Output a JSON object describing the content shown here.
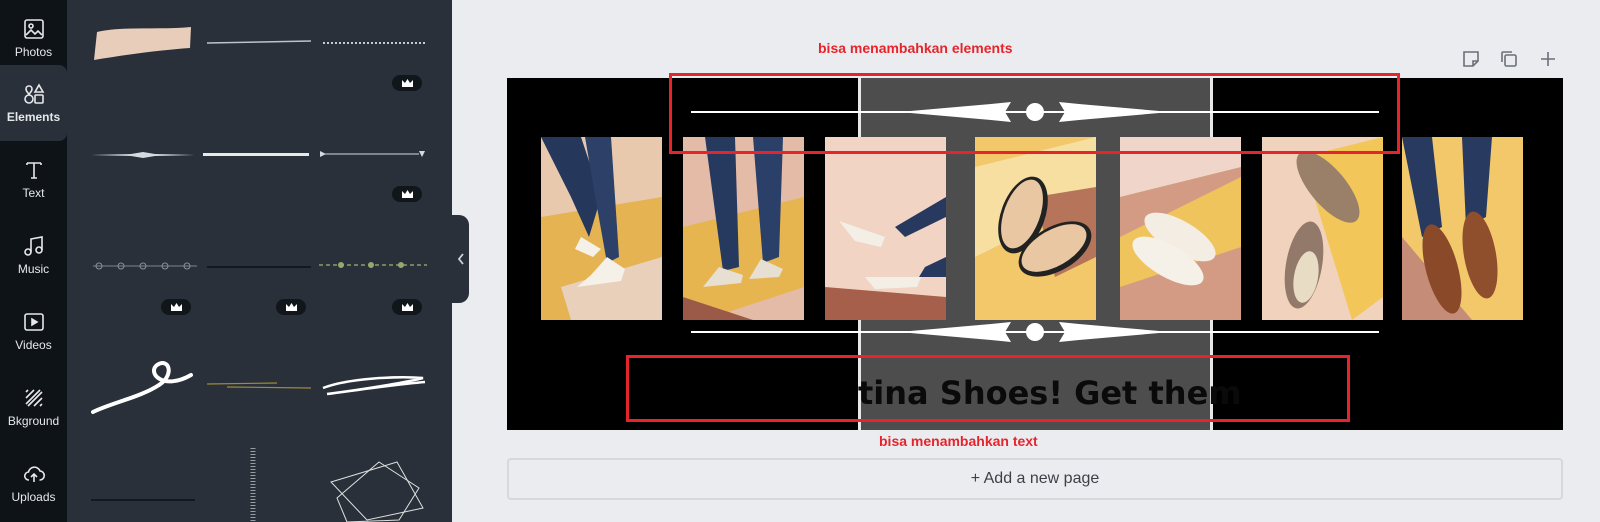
{
  "rail": {
    "items": [
      {
        "label": "Photos"
      },
      {
        "label": "Elements"
      },
      {
        "label": "Text"
      },
      {
        "label": "Music"
      },
      {
        "label": "Videos"
      },
      {
        "label": "Bkground"
      },
      {
        "label": "Uploads"
      }
    ],
    "active": "Elements"
  },
  "annotations": {
    "elements_note": "bisa menambahkan elements",
    "text_note": "bisa menambahkan text"
  },
  "design": {
    "text": "tina Shoes! Get them"
  },
  "add_page_label": "+ Add a new page",
  "colors": {
    "rail_bg": "#0e1318",
    "panel_bg": "#293039",
    "canvas_bg": "#ebecf0",
    "annotation_red": "#e5252b",
    "design_bg": "#000000",
    "band_gray": "#4d4d4d"
  }
}
